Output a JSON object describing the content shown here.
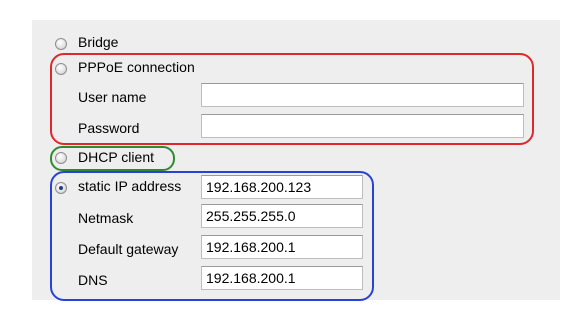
{
  "options": {
    "bridge": {
      "label": "Bridge",
      "checked": false
    },
    "pppoe": {
      "label": "PPPoE connection",
      "checked": false
    },
    "dhcp": {
      "label": "DHCP client",
      "checked": false
    },
    "static": {
      "label": "static IP address",
      "checked": true
    }
  },
  "pppoe_fields": {
    "username_label": "User name",
    "username_value": "",
    "password_label": "Password",
    "password_value": ""
  },
  "static_fields": {
    "ip_value": "192.168.200.123",
    "netmask_label": "Netmask",
    "netmask_value": "255.255.255.0",
    "gateway_label": "Default gateway",
    "gateway_value": "192.168.200.1",
    "dns_label": "DNS",
    "dns_value": "192.168.200.1"
  },
  "highlight_colors": {
    "pppoe_group": "#e0282c",
    "dhcp_group": "#2e8b2e",
    "static_group": "#2942d6"
  }
}
